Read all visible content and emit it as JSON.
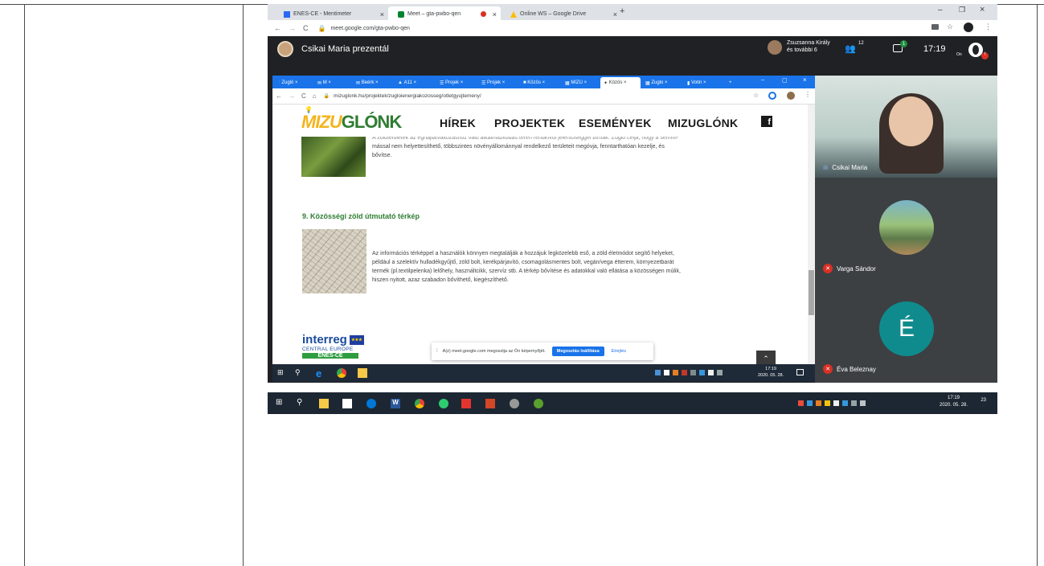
{
  "outer_browser": {
    "tabs": [
      {
        "label": "ENES-CE - Mentimeter",
        "icon": "mentimeter-icon"
      },
      {
        "label": "Meet – gta-pwbo-qen",
        "icon": "meet-icon"
      },
      {
        "label": "Online WS – Google Drive",
        "icon": "drive-icon"
      }
    ],
    "url": "meet.google.com/gta-pwbo-qen",
    "window_controls": {
      "min": "–",
      "max": "❐",
      "close": "×"
    }
  },
  "meet": {
    "presenter_label": "Csikai Maria prezentál",
    "participants_label_line1": "Zsuzsanna Király",
    "participants_label_line2": "és további 6",
    "people_count": "12",
    "chat_badge": "1",
    "time": "17:19",
    "on_label": "On",
    "participants": [
      {
        "name": "Csikai Maria",
        "mic": "speaking"
      },
      {
        "name": "Varga Sándor",
        "mic": "muted"
      },
      {
        "name": "Éva Beleznay",
        "mic": "muted",
        "initial": "É"
      }
    ]
  },
  "inner_browser": {
    "tabs": [
      "Zugló",
      "M",
      "Beérk",
      "A11",
      "Projek",
      "Projek",
      "Közös",
      "MIZU",
      "Közös",
      "Zuglo",
      "Votin"
    ],
    "url": "mizuglonk.hu/projektek/zugloienergiakozosseg/otletgyujtemeny/"
  },
  "site": {
    "logo_part1": "MIZU",
    "logo_part2": "GLÓNK",
    "nav": [
      "HÍREK",
      "PROJEKTEK",
      "ESEMÉNYEK",
      "MIZUGLÓNK"
    ],
    "prev_text_line1": "A zöldfelületek az éghajlatváltozáshoz való alkalmazkodás terén rendkívül jelentőséggel bírnak. Zugló célja, hogy a semmi-",
    "prev_text_line2": "mással nem helyettesíthető, többszintes növényállománnyal rendelkező területeit megóvja, fenntarthatóan kezelje, és",
    "prev_text_line3": "bővítse.",
    "section_title": "9. Közösségi zöld útmutató térkép",
    "section_text": [
      "Az információs térképpel a használók könnyen megtalálják a hozzájuk legközelebb eső, a zöld életmódot segítő helyeket,",
      "például a szelektív hulladékgyűjtő, zöld bolt, kerékpárjavító, csomagolásmentes bolt, vegán/vega étterem, környezetbarát",
      "termék (pl.textilpelenka) lelőhely, használtcikk, szervíz stb. A térkép bővítése és adatokkal való ellátása a közösségen múlik,",
      "hiszen nyitott, azaz szabadon bővíthető, kiegészíthető."
    ],
    "interreg": "interreg",
    "central_europe": "CENTRAL EUROPE",
    "enes": "ENES-CE",
    "share_notice": "A(z) meet.google.com megosztja az Ön képernyőjét.",
    "stop_share_button": "Megosztás leállítása",
    "hide_link": "Elrejtés"
  },
  "inner_taskbar": {
    "time": "17:19",
    "date": "2020. 05. 28."
  },
  "outer_taskbar": {
    "time": "17:19",
    "date": "2020. 05. 28.",
    "notif": "23"
  },
  "colors": {
    "meet_bg": "#202124",
    "accent_blue": "#1a73e8",
    "green_title": "#2e7d32",
    "mute_red": "#d93025"
  }
}
